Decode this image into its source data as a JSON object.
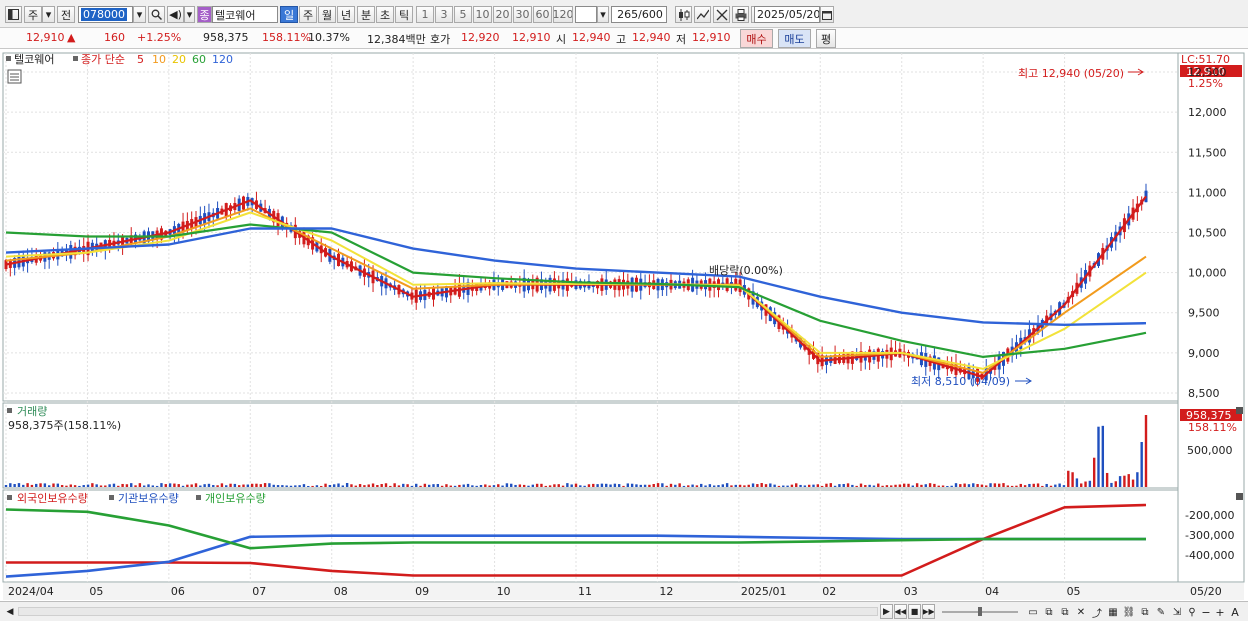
{
  "toolbar": {
    "menu1": "주",
    "menu2": "전",
    "stock_code": "078000",
    "stock_name_tag": "종",
    "stock_name": "텔코웨어",
    "periods": [
      "일",
      "주",
      "월",
      "년",
      "분",
      "초",
      "틱"
    ],
    "ranges": [
      "1",
      "3",
      "5",
      "10",
      "20",
      "30",
      "60",
      "120"
    ],
    "count": "265",
    "count_total": "/600",
    "date": "2025/05/20"
  },
  "info": {
    "price": "12,910",
    "change_arrow": "▲",
    "change": "160",
    "change_pct": "+1.25%",
    "volume": "958,375",
    "vol_ratio": "158.11%",
    "turnover": "10.37%",
    "amount": "12,384백만",
    "quote_label": "호가",
    "ask": "12,920",
    "bid": "12,910",
    "open_label": "시",
    "open": "12,940",
    "high_label": "고",
    "high": "12,940",
    "low_label": "저",
    "low": "12,910",
    "buy_label": "매수",
    "sell_label": "매도",
    "avg_label": "평"
  },
  "price_panel": {
    "name": "텔코웨어",
    "legend_title": "종가 단순",
    "ma_periods": [
      "5",
      "10",
      "20",
      "60",
      "120"
    ],
    "lc_label": "LC:51.70",
    "current_price": "12,910",
    "current_pct": "1.25%",
    "y_ticks": [
      "12,500",
      "12,000",
      "11,500",
      "11,000",
      "10,500",
      "10,000",
      "9,500",
      "9,000",
      "8,500"
    ],
    "high_note": "최고 12,940 (05/20)",
    "low_note": "최저 8,510 (04/09)",
    "dividend_note": "배당락(0.00%)"
  },
  "volume_panel": {
    "title": "거래량",
    "summary": "958,375주(158.11%)",
    "current": "958,375",
    "current_pct": "158.11%",
    "y_ticks": [
      "500,000"
    ]
  },
  "holdings_panel": {
    "series_labels": [
      "외국인보유수량",
      "기관보유수량",
      "개인보유수량"
    ],
    "y_ticks": [
      "-200,000",
      "-300,000",
      "-400,000"
    ]
  },
  "x_axis": {
    "labels": [
      "2024/04",
      "05",
      "06",
      "07",
      "08",
      "09",
      "10",
      "11",
      "12",
      "2025/01",
      "02",
      "03",
      "04",
      "05"
    ],
    "right_label": "05/20"
  },
  "colors": {
    "up": "#d21c1c",
    "down": "#1f4fbf",
    "ma5": "#d21c1c",
    "ma10": "#f29b1d",
    "ma20": "#f2e23a",
    "ma60": "#27a035",
    "ma120": "#2f63d8"
  },
  "chart_data": {
    "type": "line",
    "title": "텔코웨어",
    "x": [
      "2024/04",
      "05",
      "06",
      "07",
      "08",
      "09",
      "10",
      "11",
      "12",
      "2025/01",
      "02",
      "03",
      "04",
      "05",
      "05/20"
    ],
    "series": [
      {
        "name": "5",
        "values": [
          10100,
          10300,
          10500,
          10900,
          10200,
          9700,
          9850,
          9850,
          9850,
          9850,
          8900,
          9000,
          8700,
          9600,
          10950
        ]
      },
      {
        "name": "10",
        "values": [
          10150,
          10250,
          10450,
          10800,
          10300,
          9800,
          9850,
          9860,
          9850,
          9850,
          8950,
          9000,
          8750,
          9500,
          10200
        ]
      },
      {
        "name": "20",
        "values": [
          10200,
          10250,
          10400,
          10750,
          10400,
          9850,
          9870,
          9860,
          9860,
          9840,
          9000,
          9000,
          8800,
          9300,
          10000
        ]
      },
      {
        "name": "60",
        "values": [
          10500,
          10450,
          10450,
          10600,
          10500,
          10000,
          9930,
          9880,
          9860,
          9820,
          9400,
          9150,
          8950,
          9050,
          9250
        ]
      },
      {
        "name": "120",
        "values": [
          10250,
          10300,
          10350,
          10550,
          10550,
          10300,
          10150,
          10050,
          10000,
          9950,
          9700,
          9500,
          9380,
          9350,
          9370
        ]
      }
    ],
    "ylim": [
      8400,
      12700
    ],
    "highlights": {
      "high": {
        "date": "05/20",
        "value": 12940
      },
      "low": {
        "date": "04/09",
        "value": 8510
      }
    },
    "volume": {
      "last": 958375,
      "ratio_pct": 158.11
    },
    "holdings": {
      "foreign": [
        -403000,
        -403000,
        -403000,
        -405000,
        -440000,
        -460000,
        -460000,
        -460000,
        -460000,
        -460000,
        -460000,
        -460000,
        -300000,
        -160000,
        -150000
      ],
      "institution": [
        -465000,
        -440000,
        -400000,
        -290000,
        -285000,
        -285000,
        -285000,
        -285000,
        -285000,
        -290000,
        -295000,
        -300000,
        -300000,
        -300000,
        -300000
      ],
      "individual": [
        -170000,
        -180000,
        -240000,
        -340000,
        -320000,
        -315000,
        -315000,
        -315000,
        -315000,
        -315000,
        -310000,
        -305000,
        -300000,
        -300000,
        -300000
      ]
    }
  }
}
